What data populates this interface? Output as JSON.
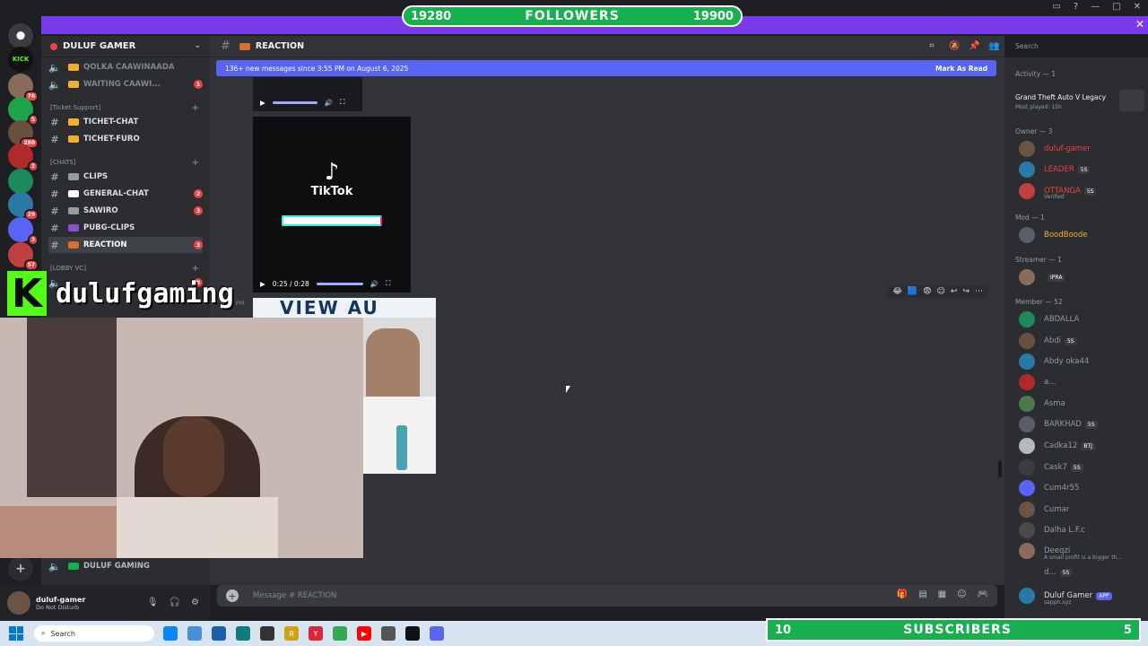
{
  "stream": {
    "followers_left": "19280",
    "followers_label": "FOLLOWERS",
    "followers_right": "19900",
    "subscribers_left": "10",
    "subscribers_label": "SUBSCRIBERS",
    "subscribers_right": "5",
    "brand_letter": "K",
    "brand_name": "dulufgaming"
  },
  "servers": [
    {
      "label": "KICK",
      "color": "#53fc18"
    },
    {
      "label": "",
      "color": "#8a6b5a",
      "badge": "76"
    },
    {
      "label": "",
      "color": "#1fa34a",
      "badge": "5"
    },
    {
      "label": "",
      "color": "#6b4f3e",
      "badge": "280"
    },
    {
      "label": "",
      "color": "#b02a2a",
      "badge": "2"
    },
    {
      "label": "",
      "color": "#1c8a5a"
    },
    {
      "label": "",
      "color": "#2a7aa8",
      "badge": "29"
    },
    {
      "label": "",
      "color": "#5865f2",
      "badge": "3"
    },
    {
      "label": "",
      "color": "#c04040",
      "badge": "57"
    }
  ],
  "guild": {
    "name": "DULUF GAMER"
  },
  "channels": {
    "voice1": "QOLKA CAAWINAADA",
    "voice2": "WAITING CAAWI...",
    "voice2_count": "1",
    "cat_ticket": "[Ticket Support]",
    "ticket_chat": "TICHET-CHAT",
    "ticket_furo": "TICHET-FURO",
    "cat_chats": "[CHATS]",
    "clips": "CLIPS",
    "general": "GENERAL-CHAT",
    "general_count": "2",
    "sawiro": "SAWIRO",
    "sawiro_count": "3",
    "pubg": "PUBG-CLIPS",
    "reaction": "REACTION",
    "reaction_count": "3",
    "cat_lobby": "[LOBBY VC]",
    "lobby_count": "8",
    "duluf_gaming": "DULUF GAMING"
  },
  "header": {
    "channel": "REACTION"
  },
  "search": {
    "placeholder": "Search"
  },
  "newbar": {
    "text": "136+ new messages since 3:55 PM on August 6, 2025",
    "mark": "Mark As Read"
  },
  "video1": {
    "brand": "TikTok"
  },
  "video2": {
    "time": "0:25 / 0:28",
    "brand": "TikTok",
    "overlay_text": "VIEW AU",
    "timestamp": "5:51 PM"
  },
  "composer": {
    "placeholder": "Message # REACTION"
  },
  "user": {
    "name": "duluf-gamer",
    "status": "Do Not Disturb"
  },
  "members": {
    "activity_head": "Activity — 1",
    "activity_game": "Grand Theft Auto V Legacy",
    "activity_sub": "Most played: 15h",
    "owner_head": "Owner — 3",
    "owners": [
      "duluf-gamer",
      "LEADER",
      "OTTANGA"
    ],
    "owner_tags": [
      "",
      "5S",
      "5S"
    ],
    "owner_sub": "Verified",
    "mod_head": "Mod — 1",
    "mods": [
      "BoodBoode"
    ],
    "streamer_head": "Streamer — 1",
    "streamer_tag": "IPRA",
    "member_head": "Member — 52",
    "list": [
      "ABDALLA",
      "Abdi",
      "Abdy oka44",
      "a...",
      "Asma",
      "BARKHAD",
      "Cadka12",
      "Cask7",
      "Cum4r55",
      "Cumar",
      "Dalha L.F.c",
      "Deeqzi",
      "d...",
      "Duluf Gamer"
    ],
    "tags": [
      "",
      "5S",
      "",
      "",
      "",
      "5S",
      "BTJ",
      "5S",
      "",
      "",
      "",
      "",
      "5S",
      "APP"
    ],
    "deeqzi_sub": "A small profit is a bigger th...",
    "duluf_sub": "sapph.xyz"
  },
  "taskbar": {
    "search": "Search"
  }
}
